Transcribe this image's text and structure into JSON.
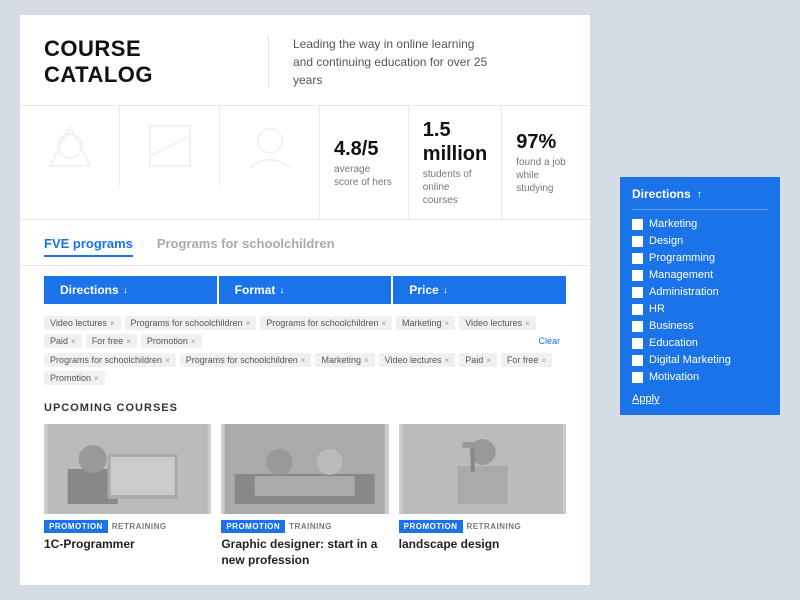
{
  "header": {
    "title": "COURSE CATALOG",
    "tagline": "Leading the way in online learning and continuing education for over 25 years",
    "divider": true
  },
  "stats": [
    {
      "value": "4.8/5",
      "label": "average score of hers"
    },
    {
      "value": "1.5 million",
      "label": "students of online courses"
    },
    {
      "value": "97%",
      "label": "found a job while studying"
    }
  ],
  "tabs": [
    {
      "label": "FVE programs",
      "active": true
    },
    {
      "label": "Programs for schoolchildren",
      "active": false
    }
  ],
  "filters": [
    {
      "label": "Directions",
      "arrow": "↓"
    },
    {
      "label": "Format",
      "arrow": "↓"
    },
    {
      "label": "Price",
      "arrow": "↓"
    }
  ],
  "tags_row1": [
    "Video lectures ×",
    "Programs for schoolchildren ×",
    "Programs for schoolchildren ×",
    "Marketing ×",
    "Video lectures ×",
    "Paid ×",
    "For free ×",
    "Promotion ×"
  ],
  "tags_row2": [
    "Programs for schoolchildren ×",
    "Programs for schoolchildren ×",
    "Marketing ×",
    "Video lectures ×",
    "Paid ×",
    "For free ×",
    "Promotion ×"
  ],
  "clear_label": "Clear",
  "upcoming_title": "UPCOMING COURSES",
  "courses": [
    {
      "badge_promo": "PROMOTION",
      "badge_type": "RETRAINING",
      "title": "1C-Programmer",
      "img_style": "programmer"
    },
    {
      "badge_promo": "PROMOTION",
      "badge_type": "TRAINING",
      "title": "Graphic designer: start in a new profession",
      "img_style": "designer"
    },
    {
      "badge_promo": "PROMOTION",
      "badge_type": "RETRAINING",
      "title": "landscape design",
      "img_style": "landscape"
    }
  ],
  "dropdown": {
    "title": "Directions",
    "arrow": "↑",
    "items": [
      "Marketing",
      "Design",
      "Programming",
      "Management",
      "Administration",
      "HR",
      "Business",
      "Education",
      "Digital Marketing",
      "Motivation"
    ],
    "apply_label": "Apply"
  }
}
